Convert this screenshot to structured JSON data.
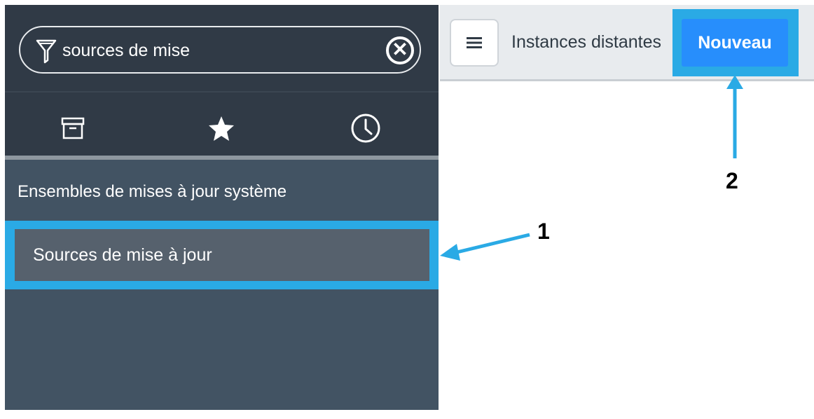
{
  "sidebar": {
    "filter": {
      "value": "sources de mise"
    },
    "tabs": [
      {
        "name": "archive",
        "icon": "archive-icon"
      },
      {
        "name": "favorites",
        "icon": "star-icon"
      },
      {
        "name": "history",
        "icon": "clock-icon"
      }
    ],
    "section_title": "Ensembles de mises à jour système",
    "items": [
      {
        "label": "Sources de mise à jour",
        "highlighted": true
      }
    ]
  },
  "header": {
    "title": "Instances distantes",
    "new_button_label": "Nouveau"
  },
  "callouts": {
    "one": "1",
    "two": "2"
  },
  "colors": {
    "sidebar_bg": "#425363",
    "sidebar_top_bg": "#303a46",
    "highlight": "#2aaae5",
    "primary_button": "#278efc"
  }
}
